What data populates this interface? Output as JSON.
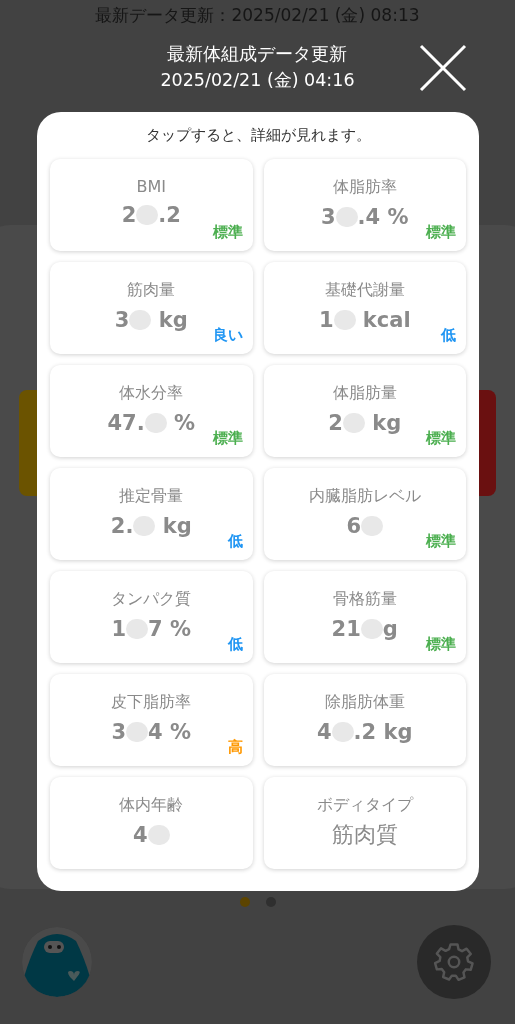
{
  "background": {
    "update_text": "最新データ更新：2025/02/21 (金) 08:13"
  },
  "dialog": {
    "title": "最新体組成データ更新",
    "date": "2025/02/21 (金) 04:16",
    "hint": "タップすると、詳細が見れます。",
    "items": [
      {
        "label": "BMI",
        "value_before": "2",
        "value_after": ".2",
        "redacted": true,
        "rating": "標準",
        "color": "#4caf50"
      },
      {
        "label": "体脂肪率",
        "value_before": "3",
        "value_after": ".4 %",
        "redacted": true,
        "rating": "標準",
        "color": "#4caf50"
      },
      {
        "label": "筋肉量",
        "value_before": "3",
        "value_after": " kg",
        "redacted": true,
        "rating": "良い",
        "color": "#2196f3"
      },
      {
        "label": "基礎代謝量",
        "value_before": "1",
        "value_after": " kcal",
        "redacted": true,
        "rating": "低",
        "color": "#2196f3"
      },
      {
        "label": "体水分率",
        "value_before": "47.",
        "value_after": " %",
        "redacted": true,
        "rating": "標準",
        "color": "#4caf50"
      },
      {
        "label": "体脂肪量",
        "value_before": "2",
        "value_after": " kg",
        "redacted": true,
        "rating": "標準",
        "color": "#4caf50"
      },
      {
        "label": "推定骨量",
        "value_before": "2.",
        "value_after": " kg",
        "redacted": true,
        "rating": "低",
        "color": "#2196f3"
      },
      {
        "label": "内臓脂肪レベル",
        "value_before": "6",
        "redacted": true,
        "rating": "標準",
        "color": "#4caf50"
      },
      {
        "label": "タンパク質",
        "value_before": "1",
        "value_after": "7 %",
        "redacted": true,
        "rating": "低",
        "color": "#2196f3"
      },
      {
        "label": "骨格筋量",
        "value_before": "21",
        "value_after": "g",
        "redacted": true,
        "rating": "標準",
        "color": "#4caf50"
      },
      {
        "label": "皮下脂肪率",
        "value_before": "3",
        "value_after": "4 %",
        "redacted": true,
        "rating": "高",
        "color": "#ff9800"
      },
      {
        "label": "除脂肪体重",
        "value_before": "4",
        "value_after": ".2 kg",
        "redacted": true
      },
      {
        "label": "体内年齢",
        "value_before": "4",
        "redacted": true
      },
      {
        "label": "ボディタイプ",
        "value_before": "筋肉質",
        "redacted": false
      }
    ]
  },
  "pager": [
    {
      "selected": true
    },
    {
      "selected": false
    }
  ]
}
